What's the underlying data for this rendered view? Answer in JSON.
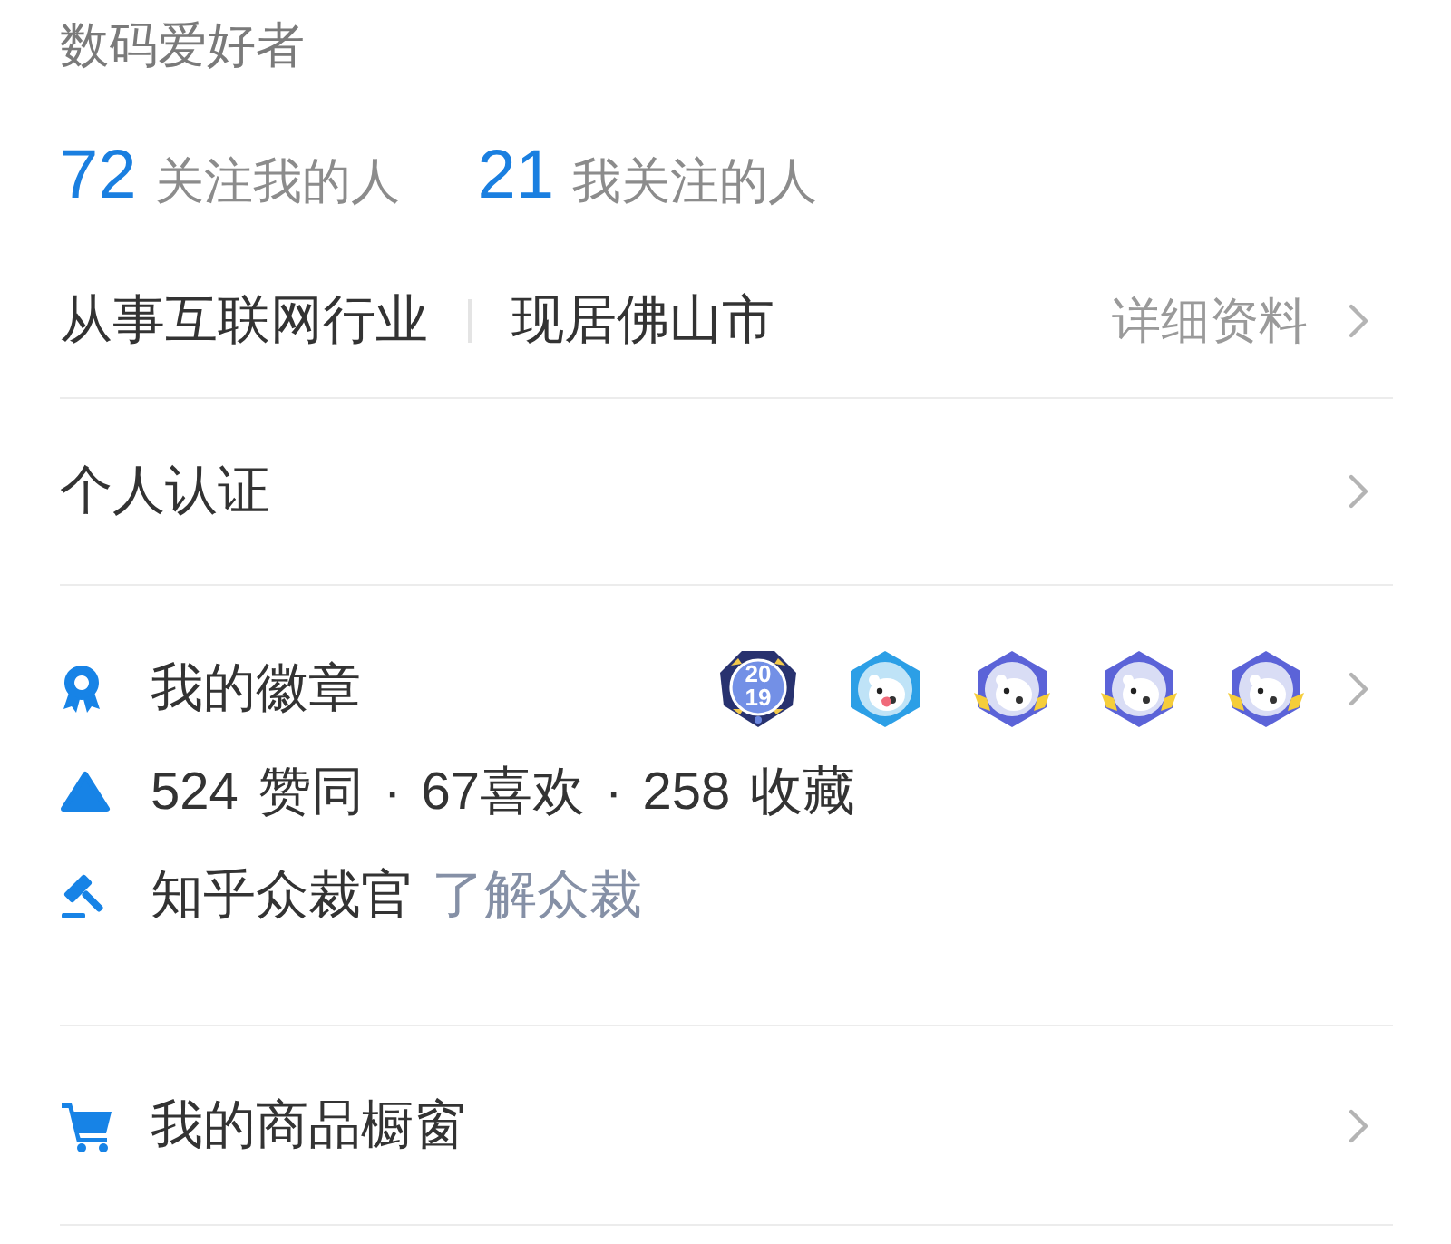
{
  "profile": {
    "headline": "数码爱好者",
    "follow_stats": [
      {
        "count": "72",
        "label": "关注我的人"
      },
      {
        "count": "21",
        "label": "我关注的人"
      }
    ],
    "details": [
      "从事互联网行业",
      "现居佛山市"
    ],
    "details_link": "详细资料"
  },
  "verification": {
    "label": "个人认证"
  },
  "achievements": [
    {
      "kind": "badges",
      "label": "我的徽章",
      "badges": [
        {
          "kind": "year",
          "text": "2019",
          "color": "#28326f"
        },
        {
          "kind": "bear",
          "color": "#2c9fe6"
        },
        {
          "kind": "bear-winged",
          "color": "#5b63d8"
        },
        {
          "kind": "bear-winged",
          "color": "#5b63d8"
        },
        {
          "kind": "bear-winged",
          "color": "#5b63d8"
        }
      ]
    },
    {
      "kind": "stats",
      "text": "524 赞同 · 67喜欢 · 258 收藏"
    },
    {
      "kind": "moderator",
      "label": "知乎众裁官",
      "link": "了解众裁"
    }
  ],
  "shop_window": {
    "label": "我的商品橱窗"
  }
}
